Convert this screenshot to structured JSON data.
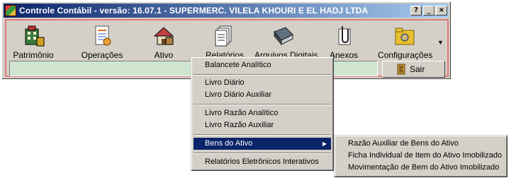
{
  "window": {
    "title": "Controle Contábil - versão: 16.07.1 - SUPERMERC. VILELA KHOURI E EL HADJ LTDA",
    "caption_buttons": {
      "help": "?",
      "minimize": "_",
      "maximize": "□",
      "close": "×"
    }
  },
  "toolbar": {
    "items": [
      {
        "label": "Patrimônio",
        "icon": "building-icon"
      },
      {
        "label": "Operações",
        "icon": "document-icon"
      },
      {
        "label": "Ativo",
        "icon": "house-icon"
      },
      {
        "label": "Relatórios",
        "icon": "reports-icon"
      },
      {
        "label": "Arquivos Digitais",
        "icon": "book-icon"
      },
      {
        "label": "Anexos",
        "icon": "paperclip-icon"
      },
      {
        "label": "Configurações",
        "icon": "folder-tools-icon"
      }
    ],
    "more_arrow": "▼",
    "exit_label": "Sair"
  },
  "menu": {
    "items": [
      {
        "label": "Balancete Analítico"
      },
      {
        "label": "Livro Diário"
      },
      {
        "label": "Livro Diário Auxiliar"
      },
      {
        "label": "Livro Razão Analítico"
      },
      {
        "label": "Livro Razão Auxiliar"
      },
      {
        "label": "Bens do Ativo",
        "selected": true,
        "submenu_arrow": "▶"
      },
      {
        "label": "Relatórios Eletrônicos Interativos"
      }
    ],
    "submenu": [
      {
        "label": "Razão Auxiliar de Bens do Ativo"
      },
      {
        "label": "Ficha Individual de Item do Ativo Imobilizado"
      },
      {
        "label": "Movimentação de Bem do Ativo Imobilizado"
      }
    ]
  },
  "colors": {
    "title_start": "#0a246a",
    "title_end": "#a6caf0",
    "toolbar_border": "#e07a7a",
    "status_bg": "#cfe5d0",
    "highlight": "#0a246a"
  }
}
